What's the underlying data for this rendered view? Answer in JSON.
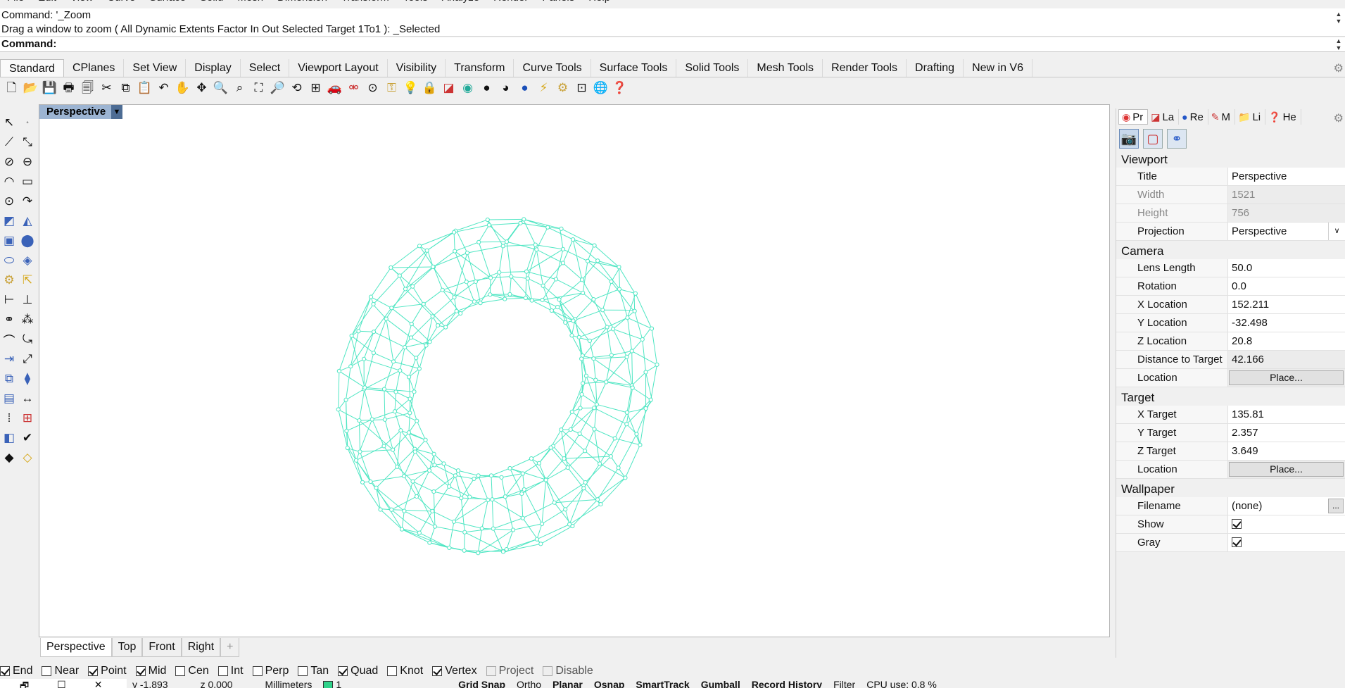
{
  "menubar": [
    "File",
    "Edit",
    "View",
    "Curve",
    "Surface",
    "Solid",
    "Mesh",
    "Dimension",
    "Transform",
    "Tools",
    "Analyze",
    "Render",
    "Panels",
    "Help"
  ],
  "command": {
    "history_line1": "Command: '_Zoom",
    "history_line2": "Drag a window to zoom ( All  Dynamic  Extents  Factor  In  Out  Selected  Target  1To1 ): _Selected",
    "prompt": "Command:"
  },
  "tabs": [
    "Standard",
    "CPlanes",
    "Set View",
    "Display",
    "Select",
    "Viewport Layout",
    "Visibility",
    "Transform",
    "Curve Tools",
    "Surface Tools",
    "Solid Tools",
    "Mesh Tools",
    "Render Tools",
    "Drafting",
    "New in V6"
  ],
  "toolbar_icons": [
    "new-icon",
    "open-icon",
    "save-icon",
    "print-icon",
    "import-icon",
    "cut-icon",
    "copy-icon",
    "paste-icon",
    "undo-icon",
    "pan-icon",
    "rotate-view-icon",
    "zoom-icon",
    "zoom-window-icon",
    "zoom-extents-icon",
    "zoom-selected-icon",
    "rotate-icon",
    "four-viewports-icon",
    "car-icon",
    "hide-icon",
    "show-icon",
    "lock-icon",
    "light-icon",
    "padlock-icon",
    "layer-icon",
    "color-wheel-icon",
    "sphere-icon",
    "rendered-sphere-icon",
    "render-icon",
    "flash-icon",
    "gear-set-icon",
    "grid-dim-icon",
    "globe-icon",
    "help-icon"
  ],
  "viewport": {
    "title": "Perspective",
    "tabs": [
      "Perspective",
      "Top",
      "Front",
      "Right"
    ],
    "add_tab": "+"
  },
  "osnap": [
    {
      "label": "End",
      "checked": true
    },
    {
      "label": "Near",
      "checked": false
    },
    {
      "label": "Point",
      "checked": true
    },
    {
      "label": "Mid",
      "checked": true
    },
    {
      "label": "Cen",
      "checked": false
    },
    {
      "label": "Int",
      "checked": false
    },
    {
      "label": "Perp",
      "checked": false
    },
    {
      "label": "Tan",
      "checked": false
    },
    {
      "label": "Quad",
      "checked": true
    },
    {
      "label": "Knot",
      "checked": false
    },
    {
      "label": "Vertex",
      "checked": true
    },
    {
      "label": "Project",
      "checked": false
    },
    {
      "label": "Disable",
      "checked": false
    }
  ],
  "status": {
    "y": "y -1.893",
    "z": "z 0.000",
    "units": "Millimeters",
    "layer": "1",
    "grid_snap": "Grid Snap",
    "ortho": "Ortho",
    "planar": "Planar",
    "osnap": "Osnap",
    "smarttrack": "SmartTrack",
    "gumball": "Gumball",
    "record_history": "Record History",
    "filter": "Filter",
    "cpu": "CPU use: 0.8 %"
  },
  "panel": {
    "tabs": [
      "Pr",
      "La",
      "Re",
      "M",
      "Li",
      "He"
    ],
    "viewport_section": "Viewport",
    "viewport_rows": [
      {
        "key": "Title",
        "value": "Perspective"
      },
      {
        "key": "Width",
        "value": "1521"
      },
      {
        "key": "Height",
        "value": "756"
      },
      {
        "key": "Projection",
        "value": "Perspective"
      }
    ],
    "camera_section": "Camera",
    "camera_rows": [
      {
        "key": "Lens Length",
        "value": "50.0"
      },
      {
        "key": "Rotation",
        "value": "0.0"
      },
      {
        "key": "X Location",
        "value": "152.211"
      },
      {
        "key": "Y Location",
        "value": "-32.498"
      },
      {
        "key": "Z Location",
        "value": "20.8"
      },
      {
        "key": "Distance to Target",
        "value": "42.166"
      },
      {
        "key": "Location",
        "value": "Place..."
      }
    ],
    "target_section": "Target",
    "target_rows": [
      {
        "key": "X Target",
        "value": "135.81"
      },
      {
        "key": "Y Target",
        "value": "2.357"
      },
      {
        "key": "Z Target",
        "value": "3.649"
      },
      {
        "key": "Location",
        "value": "Place..."
      }
    ],
    "wallpaper_section": "Wallpaper",
    "wallpaper_rows": [
      {
        "key": "Filename",
        "value": "(none)",
        "button": "..."
      },
      {
        "key": "Show",
        "checked": true
      },
      {
        "key": "Gray",
        "checked": true
      }
    ]
  },
  "colors": {
    "wire": "#4fe6c3",
    "viewport_title_bg": "#9cb4d2",
    "layer_swatch": "#2fd28a"
  }
}
